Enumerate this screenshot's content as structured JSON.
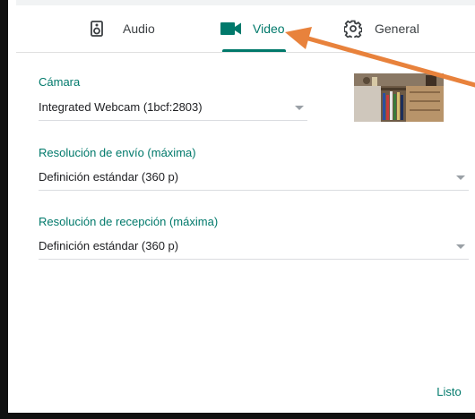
{
  "tabs": [
    {
      "label": "Audio",
      "icon": "speaker-icon"
    },
    {
      "label": "Video",
      "icon": "videocam-icon",
      "active": true
    },
    {
      "label": "General",
      "icon": "gear-icon"
    }
  ],
  "camera": {
    "label": "Cámara",
    "value": "Integrated Webcam (1bcf:2803)"
  },
  "send_resolution": {
    "label": "Resolución de envío (máxima)",
    "value": "Definición estándar (360 p)"
  },
  "receive_resolution": {
    "label": "Resolución de recepción (máxima)",
    "value": "Definición estándar (360 p)"
  },
  "footer": {
    "done_label": "Listo"
  },
  "colors": {
    "accent": "#00796b",
    "arrow": "#e8823c",
    "text": "#202124",
    "muted": "#9aa0a6"
  }
}
